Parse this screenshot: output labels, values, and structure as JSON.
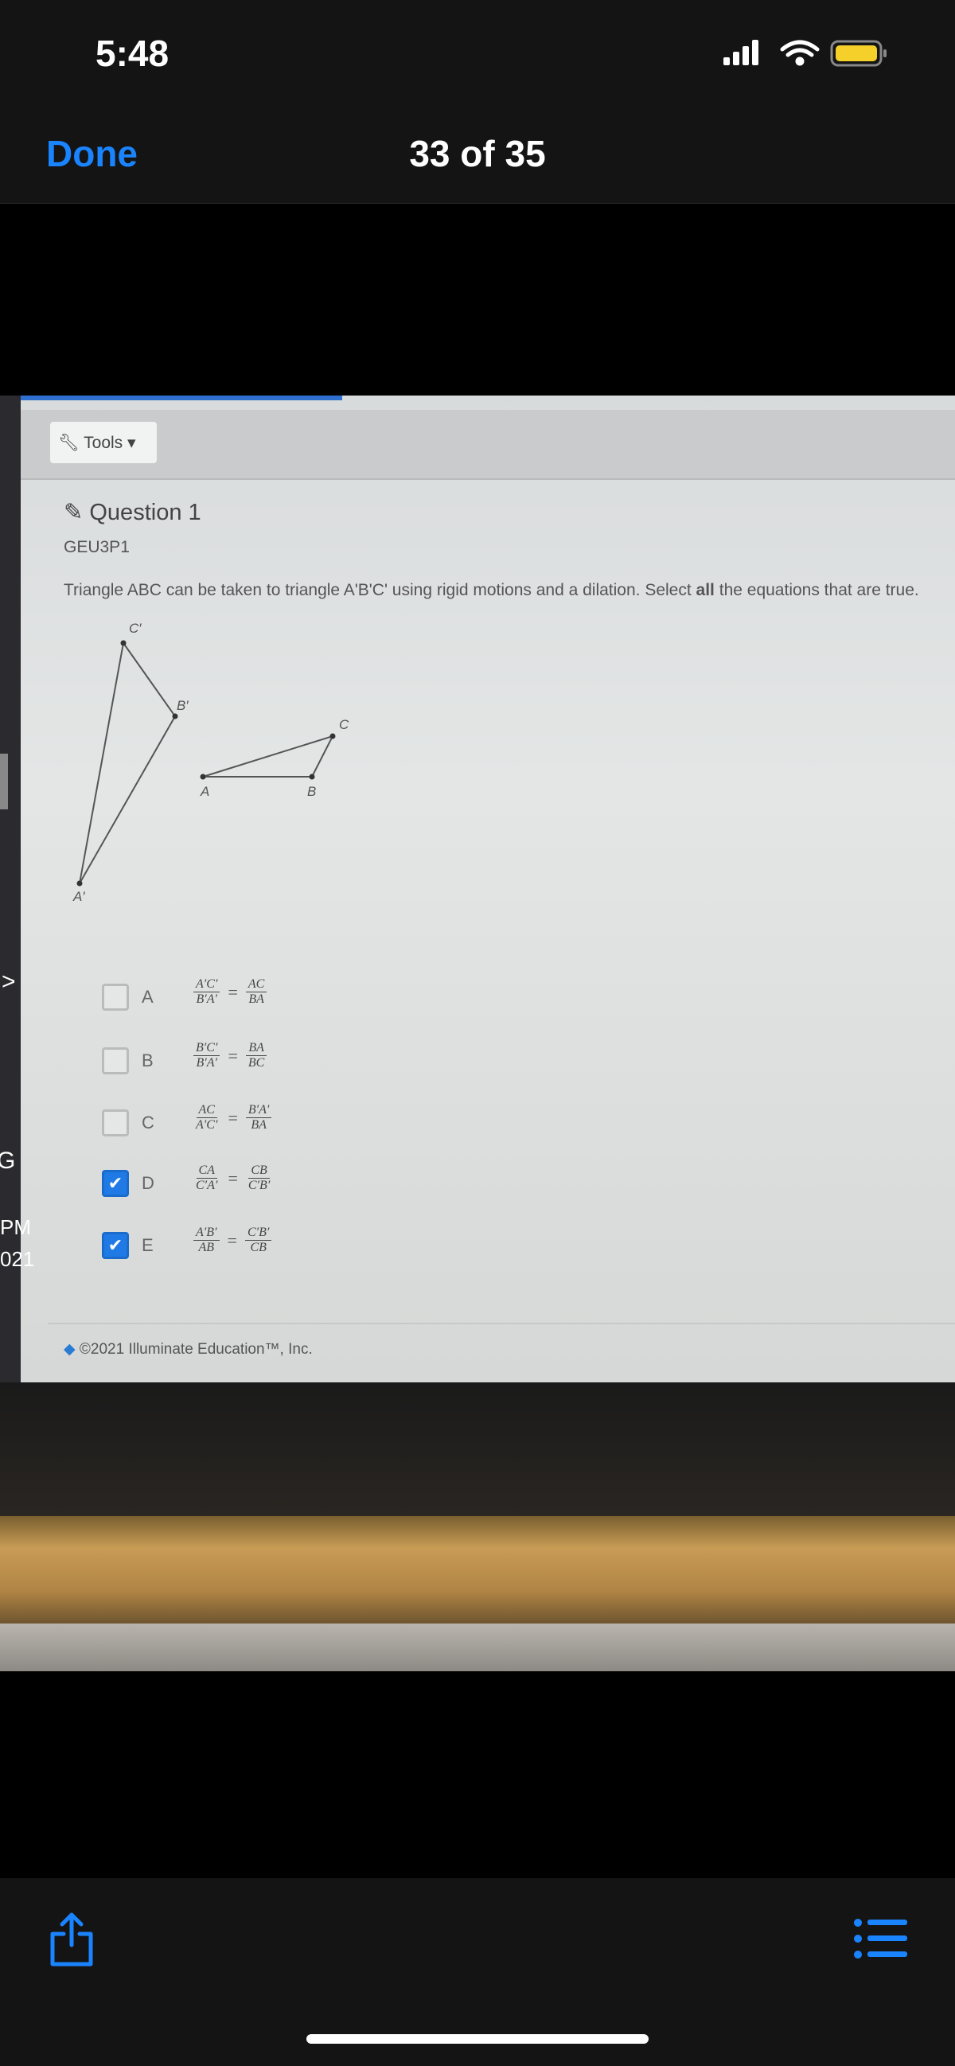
{
  "status_bar": {
    "time": "5:48",
    "icons": [
      "signal-icon",
      "wifi-icon",
      "battery-icon"
    ],
    "battery_color": "#f5d02a"
  },
  "nav": {
    "done_label": "Done",
    "counter": "33 of 35"
  },
  "toolbar": {
    "tools_label": "Tools ▾"
  },
  "question": {
    "title": "Question 1",
    "code": "GEU3P1",
    "prompt_before": "Triangle ABC can be taken to triangle A'B'C' using rigid motions and a dilation. Select ",
    "prompt_bold": "all",
    "prompt_after": " the equations that are true.",
    "diagram_labels": {
      "c1": "C′",
      "b1": "B′",
      "a1": "A′",
      "a": "A",
      "b": "B",
      "c": "C"
    },
    "options": [
      {
        "letter": "A",
        "checked": false,
        "l_num": "A′C′",
        "l_den": "B′A′",
        "r_num": "AC",
        "r_den": "BA"
      },
      {
        "letter": "B",
        "checked": false,
        "l_num": "B′C′",
        "l_den": "B′A′",
        "r_num": "BA",
        "r_den": "BC"
      },
      {
        "letter": "C",
        "checked": false,
        "l_num": "AC",
        "l_den": "A′C′",
        "r_num": "B′A′",
        "r_den": "BA"
      },
      {
        "letter": "D",
        "checked": true,
        "l_num": "CA",
        "l_den": "C′A′",
        "r_num": "CB",
        "r_den": "C′B′"
      },
      {
        "letter": "E",
        "checked": true,
        "l_num": "A′B′",
        "l_den": "AB",
        "r_num": "C′B′",
        "r_den": "CB"
      }
    ],
    "equals": "="
  },
  "footer": {
    "text": "©2021 Illuminate Education™, Inc."
  },
  "desktop_fragments": {
    "pm": "PM",
    "year": "021",
    "g": "G",
    "chevron": ">"
  },
  "accent": "#1a84ff"
}
